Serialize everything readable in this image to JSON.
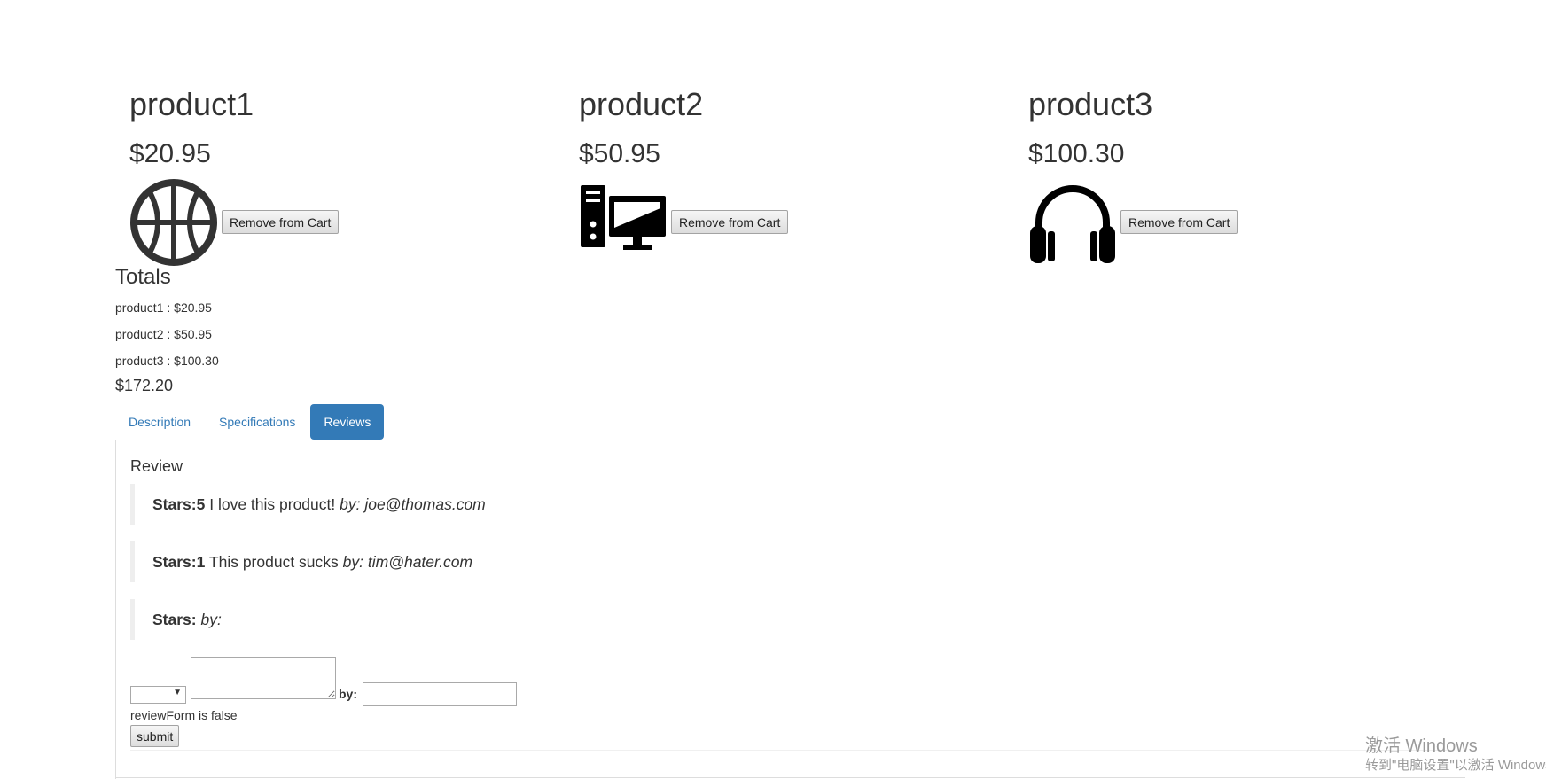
{
  "products": [
    {
      "name": "product1",
      "price": "$20.95",
      "icon": "basketball-icon",
      "remove_label": "Remove from Cart"
    },
    {
      "name": "product2",
      "price": "$50.95",
      "icon": "desktop-computer-icon",
      "remove_label": "Remove from Cart"
    },
    {
      "name": "product3",
      "price": "$100.30",
      "icon": "headphones-icon",
      "remove_label": "Remove from Cart"
    }
  ],
  "totals": {
    "title": "Totals",
    "lines": [
      "product1 : $20.95",
      "product2 : $50.95",
      "product3 : $100.30"
    ],
    "sum": "$172.20"
  },
  "tabs": {
    "items": [
      {
        "label": "Description",
        "active": false
      },
      {
        "label": "Specifications",
        "active": false
      },
      {
        "label": "Reviews",
        "active": true
      }
    ]
  },
  "reviews": {
    "title": "Review",
    "items": [
      {
        "stars_label": "Stars:5",
        "body": "I love this product!",
        "author": "by: joe@thomas.com"
      },
      {
        "stars_label": "Stars:1",
        "body": "This product sucks",
        "author": "by: tim@hater.com"
      },
      {
        "stars_label": "Stars:",
        "body": "",
        "author": "by:"
      }
    ]
  },
  "review_form": {
    "stars_value": "",
    "body_value": "",
    "by_label": "by:",
    "author_value": "",
    "status_text": "reviewForm is false",
    "submit_label": "submit"
  },
  "watermark": {
    "title": "激活 Windows",
    "subtitle": "转到\"电脑设置\"以激活 Windows。"
  },
  "colors": {
    "accent": "#337ab7",
    "text": "#333333",
    "border": "#dddddd"
  }
}
